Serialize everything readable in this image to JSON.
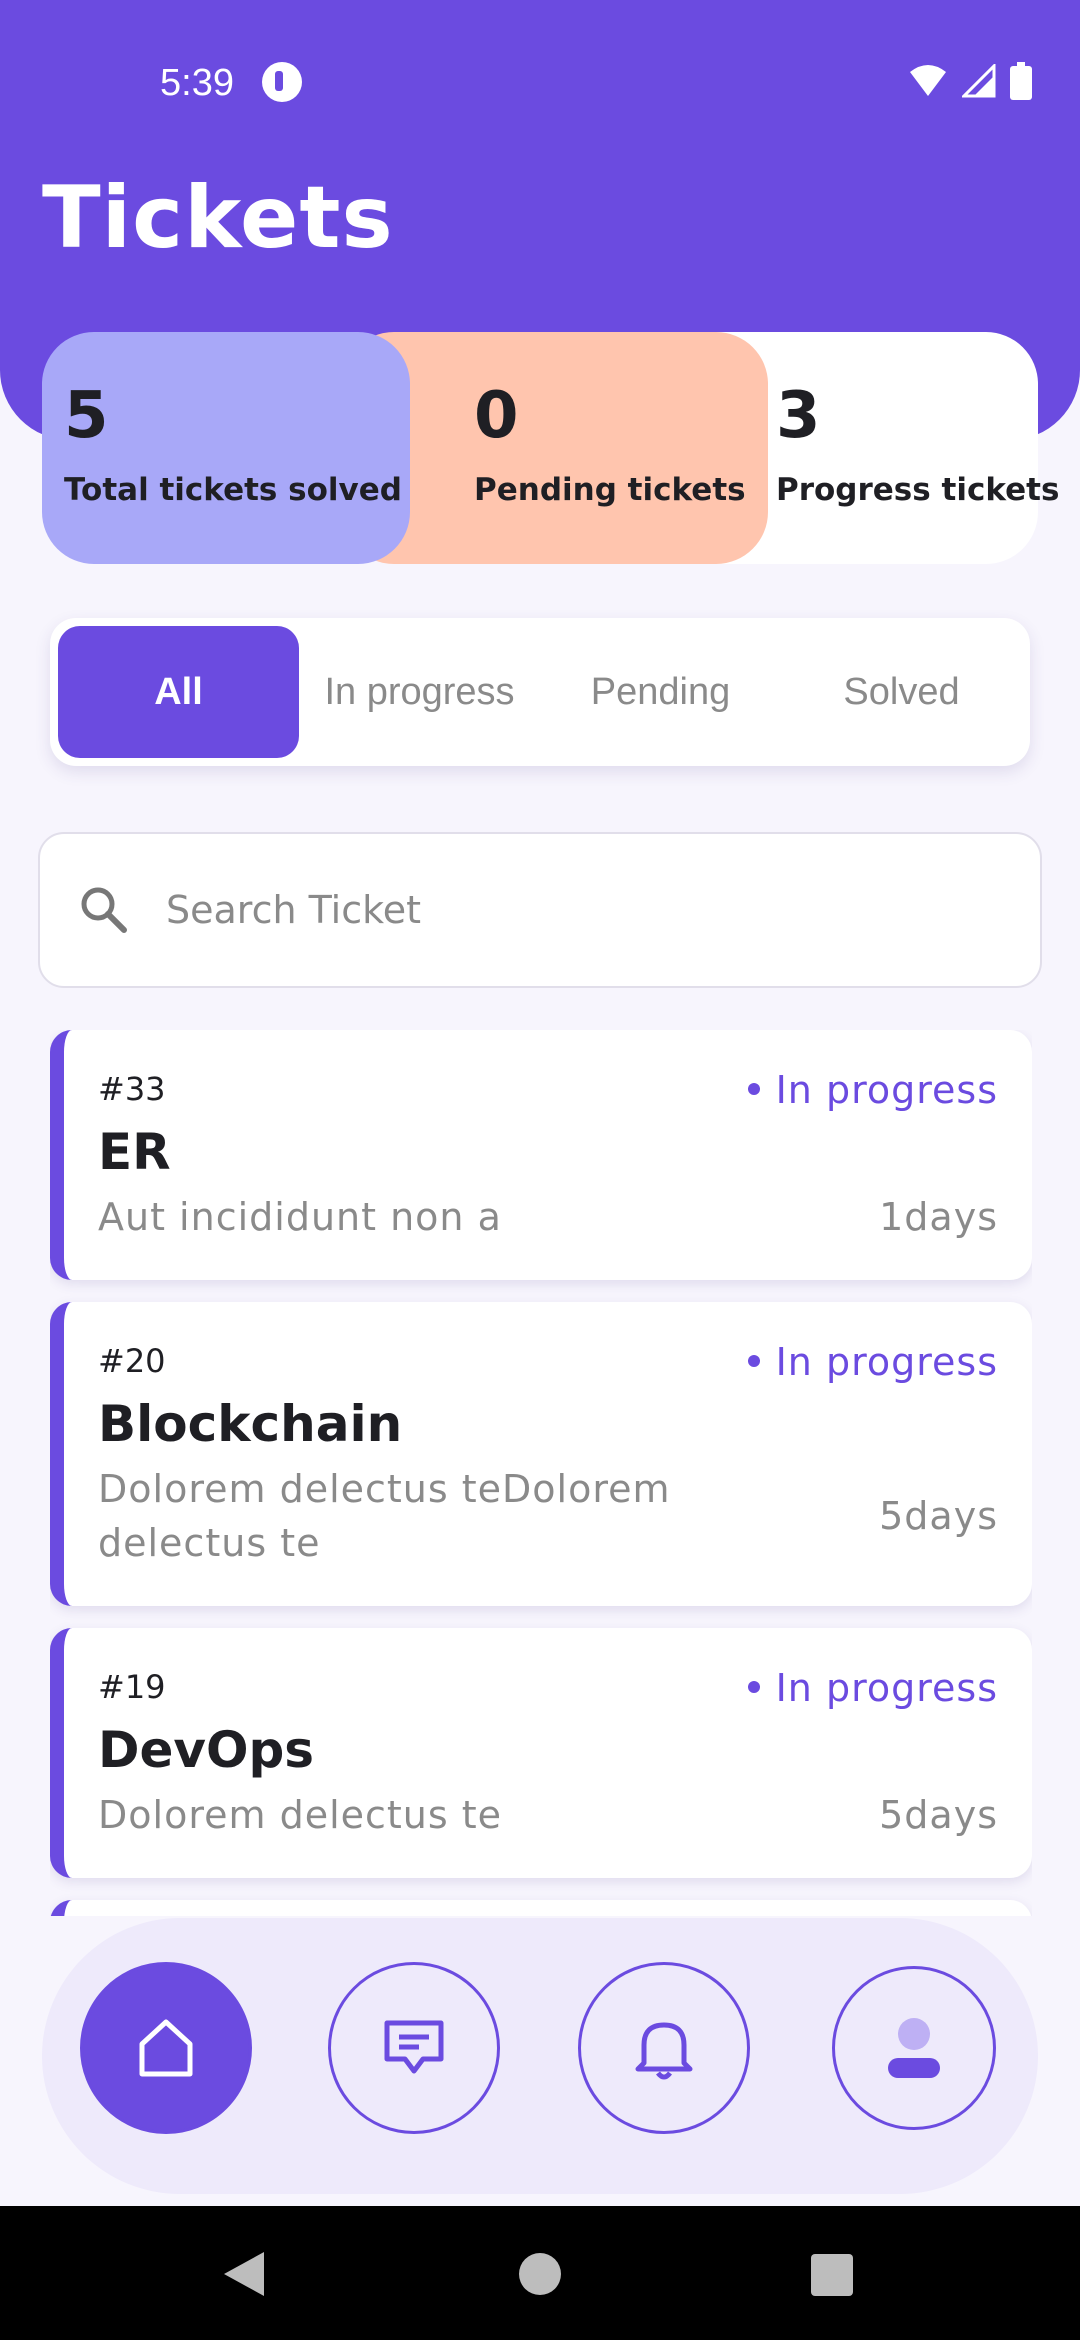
{
  "status_bar": {
    "time": "5:39"
  },
  "header": {
    "title": "Tickets"
  },
  "stats": [
    {
      "value": "5",
      "label": "Total tickets solved"
    },
    {
      "value": "0",
      "label": "Pending tickets"
    },
    {
      "value": "3",
      "label": "Progress tickets"
    }
  ],
  "tabs": [
    {
      "label": "All",
      "active": true
    },
    {
      "label": "In progress"
    },
    {
      "label": "Pending"
    },
    {
      "label": "Solved"
    }
  ],
  "search": {
    "placeholder": "Search Ticket"
  },
  "tickets": [
    {
      "id": "#33",
      "title": "ER",
      "status": "In progress",
      "description": "Aut incididunt non a",
      "age": "1days"
    },
    {
      "id": "#20",
      "title": "Blockchain",
      "status": "In progress",
      "description": "Dolorem delectus teDolorem delectus te",
      "age": "5days"
    },
    {
      "id": "#19",
      "title": "DevOps",
      "status": "In progress",
      "description": "Dolorem delectus te",
      "age": "5days"
    }
  ],
  "bottom_nav": [
    {
      "icon": "home-icon",
      "active": true
    },
    {
      "icon": "chat-icon"
    },
    {
      "icon": "bell-icon"
    },
    {
      "icon": "profile-icon"
    }
  ],
  "colors": {
    "primary": "#6B4BE0",
    "stat_blue": "#A8A8F8",
    "stat_peach": "#FFC5AE",
    "background": "#F7F5FD"
  }
}
